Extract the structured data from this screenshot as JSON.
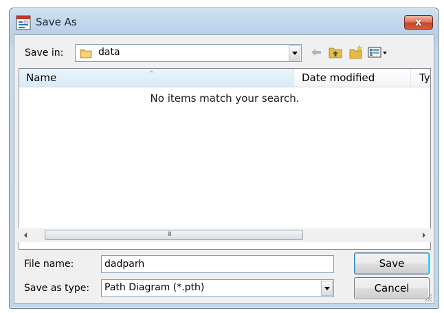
{
  "window": {
    "title": "Save As",
    "close_glyph": "x"
  },
  "toolbar": {
    "save_in_label": "Save in:",
    "save_in_value": "data",
    "icons": [
      "back-arrow-icon",
      "up-folder-icon",
      "new-folder-icon",
      "views-menu-icon"
    ]
  },
  "file_list": {
    "columns": [
      "Name",
      "Date modified",
      "Ty"
    ],
    "empty_message": "No items match your search.",
    "scroll_grip": "III"
  },
  "form": {
    "file_name_label": "File name:",
    "file_name_value": "dadparh",
    "save_type_label": "Save as type:",
    "save_type_value": "Path Diagram (*.pth)"
  },
  "buttons": {
    "save": "Save",
    "cancel": "Cancel"
  },
  "colors": {
    "accent": "#3c7fb1",
    "close": "#c8452a",
    "title_bg": "#bcd3ea",
    "folder": "#e8b84a"
  }
}
